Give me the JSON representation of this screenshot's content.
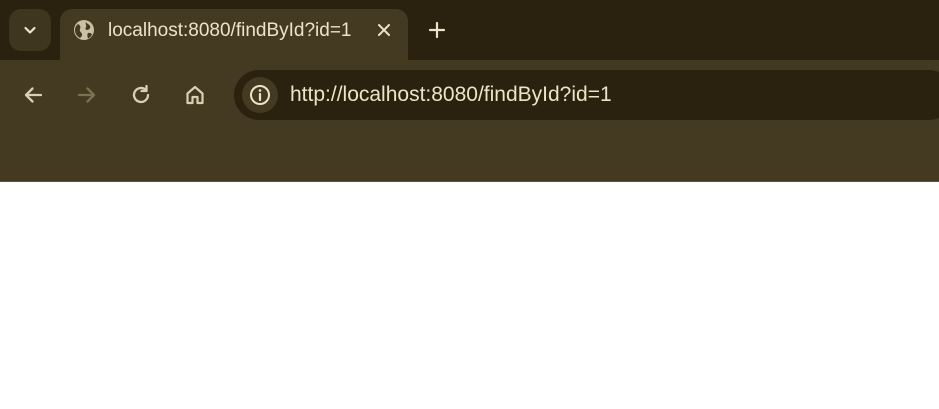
{
  "tab": {
    "title": "localhost:8080/findById?id=1",
    "favicon": "globe-icon"
  },
  "tabstrip": {
    "search_icon": "chevron-down-icon",
    "close_icon": "close-icon",
    "new_tab_icon": "plus-icon"
  },
  "toolbar": {
    "back_icon": "arrow-left-icon",
    "forward_icon": "arrow-right-icon",
    "reload_icon": "reload-icon",
    "home_icon": "home-icon",
    "site_info_icon": "info-icon"
  },
  "omnibox": {
    "url": "http://localhost:8080/findById?id=1"
  },
  "colors": {
    "tabstrip_bg": "#2a220e",
    "toolbar_bg": "#433a21",
    "omnibox_bg": "#2a220e",
    "text": "#ece3c8",
    "icon": "#d9cfb2",
    "icon_disabled": "#7a7052",
    "page_bg": "#ffffff"
  }
}
